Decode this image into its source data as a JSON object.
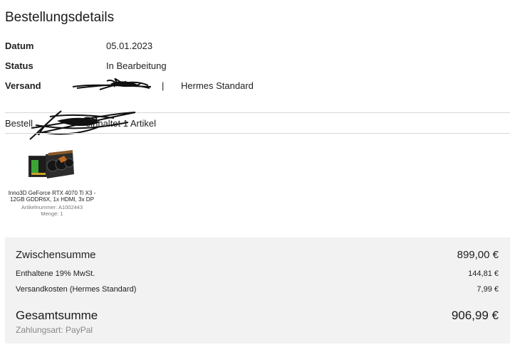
{
  "page": {
    "title": "Bestellungsdetails"
  },
  "order": {
    "date_label": "Datum",
    "date_value": "05.01.2023",
    "status_label": "Status",
    "status_value": "In Bearbeitung",
    "shipping_label": "Versand",
    "shipping_separator": "|",
    "shipping_value": "Hermes Standard"
  },
  "contents": {
    "prefix": "Bestell",
    "suffix": "einhaltet 1 Artikel"
  },
  "product": {
    "name": "Inno3D GeForce RTX 4070 Ti X3 - 12GB GDDR6X, 1x HDMI, 3x DP",
    "article_number": "Artikelnummer: A1002443",
    "quantity": "Menge: 1",
    "icon": "graphics-card-image"
  },
  "totals": {
    "subtotal_label": "Zwischensumme",
    "subtotal_value": "899,00 €",
    "vat_label": "Enthaltene 19% MwSt.",
    "vat_value": "144,81 €",
    "shipping_cost_label": "Versandkosten (Hermes Standard)",
    "shipping_cost_value": "7,99 €",
    "grand_total_label": "Gesamtsumme",
    "grand_total_value": "906,99 €",
    "payment_method": "Zahlungsart: PayPal"
  }
}
